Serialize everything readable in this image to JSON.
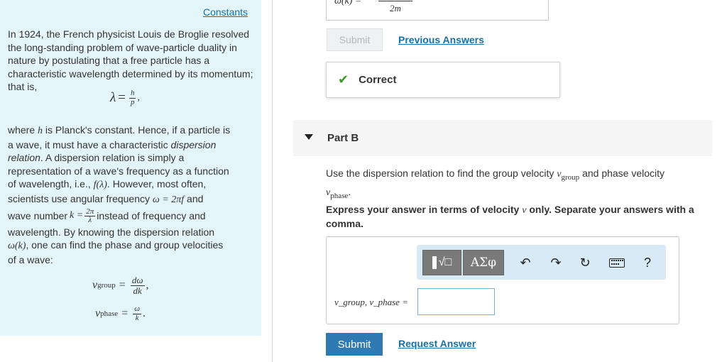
{
  "left_panel": {
    "constants_link": "Constants",
    "p1": "In 1924, the French physicist Louis de Broglie resolved the long-standing problem of wave-particle duality in nature by postulating that a free particle has a characteristic wavelength determined by its momentum; that is,",
    "lambda_eq": {
      "lhs": "λ",
      "eq": "=",
      "num": "h",
      "den": "p",
      "trail": ","
    },
    "p2": {
      "l1": "where ",
      "h": "h",
      "l1b": " is Planck's constant. Hence, if a particle is",
      "l2": "a wave, it must have a characteristic ",
      "l2i": "dispersion",
      "l3i": "relation",
      "l3": ". A dispersion relation is simply a",
      "l4": "representation of a wave's frequency as a function",
      "l5a": "of wavelength, i.e., ",
      "l5m": "f(λ)",
      "l5b": ". However, most often,",
      "l6a": "scientists use angular frequency ",
      "l6m": "ω = 2πf",
      "l6b": " and",
      "l7a": "wave number ",
      "l7m": "k =",
      "l7num": "2π",
      "l7den": "λ",
      "l7b": " instead of frequency and",
      "l8": "wavelength. By knowing the dispersion relation",
      "l9m": "ω(k)",
      "l9b": ", one can find the phase and group velocities",
      "l10": "of a wave:"
    },
    "group_eq": {
      "v": "v",
      "sub": "group",
      "eq": "=",
      "num": "dω",
      "den": "dk",
      "trail": ","
    },
    "phase_eq": {
      "v": "v",
      "sub": "phase",
      "eq": "=",
      "num": "ω",
      "den": "k",
      "trail": "."
    }
  },
  "previous_part": {
    "formula_lhs": "ω(k) =",
    "formula_den": "2m",
    "submit_label": "Submit",
    "previous_answers_label": "Previous Answers",
    "status": "Correct"
  },
  "part_b": {
    "title": "Part B",
    "instr1_a": "Use the dispersion relation to find the group velocity ",
    "instr1_v1": "v",
    "instr1_s1": "group",
    "instr1_b": " and phase velocity",
    "instr1_v2": "v",
    "instr1_s2": "phase",
    "instr1_c": ".",
    "instr2_a": "Express your answer in terms of velocity ",
    "instr2_v": "v",
    "instr2_b": " only. Separate your answers with a comma.",
    "toolbar": {
      "templates_label": "√□",
      "greek_label": "ΑΣφ",
      "undo": "↶",
      "redo": "↷",
      "reset": "↻",
      "help": "?"
    },
    "answer_label": "v_group, v_phase =",
    "answer_value": "",
    "submit_label": "Submit",
    "request_answer_label": "Request Answer"
  }
}
